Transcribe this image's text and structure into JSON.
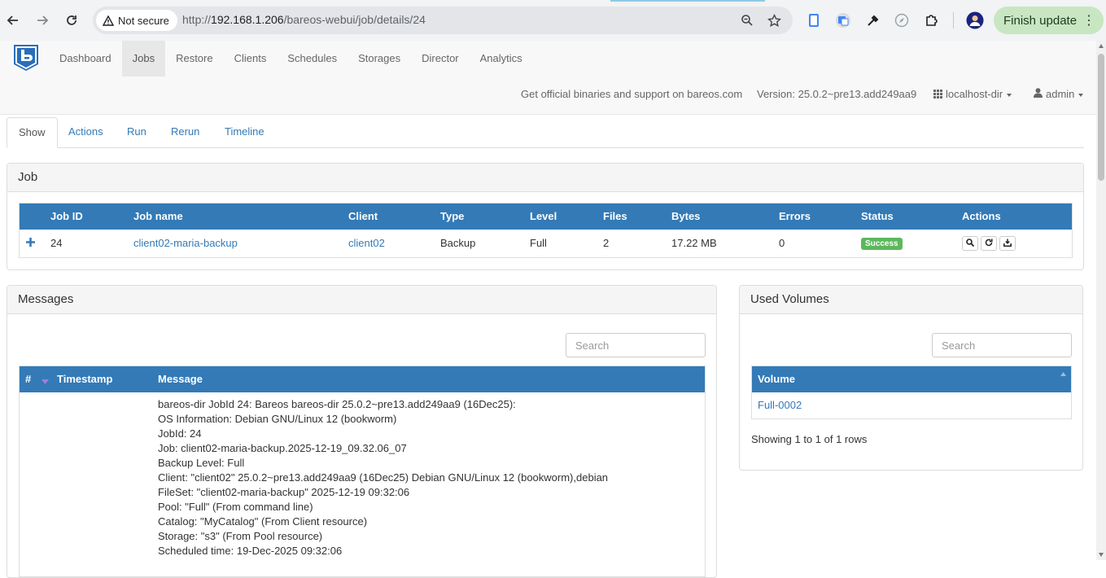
{
  "browser": {
    "secure_label": "Not secure",
    "url_scheme": "http://",
    "url_host": "192.168.1.206",
    "url_path": "/bareos-webui/job/details/24",
    "update_button": "Finish update"
  },
  "navbar": {
    "menu": [
      "Dashboard",
      "Jobs",
      "Restore",
      "Clients",
      "Schedules",
      "Storages",
      "Director",
      "Analytics"
    ],
    "active_menu": "Jobs",
    "support_text": "Get official binaries and support on bareos.com",
    "version_text": "Version: 25.0.2~pre13.add249aa9",
    "director": "localhost-dir",
    "user": "admin"
  },
  "tabs": [
    "Show",
    "Actions",
    "Run",
    "Rerun",
    "Timeline"
  ],
  "job_panel": {
    "title": "Job",
    "columns": [
      "Job ID",
      "Job name",
      "Client",
      "Type",
      "Level",
      "Files",
      "Bytes",
      "Errors",
      "Status",
      "Actions"
    ],
    "row": {
      "job_id": "24",
      "job_name": "client02-maria-backup",
      "client": "client02",
      "type": "Backup",
      "level": "Full",
      "files": "2",
      "bytes": "17.22 MB",
      "errors": "0",
      "status": "Success"
    }
  },
  "messages_panel": {
    "title": "Messages",
    "search_placeholder": "Search",
    "columns": [
      "#",
      "Timestamp",
      "Message"
    ],
    "lines": [
      "bareos-dir JobId 24: Bareos bareos-dir 25.0.2~pre13.add249aa9 (16Dec25):",
      "OS Information: Debian GNU/Linux 12 (bookworm)",
      "JobId: 24",
      "Job: client02-maria-backup.2025-12-19_09.32.06_07",
      "Backup Level: Full",
      "Client: \"client02\" 25.0.2~pre13.add249aa9 (16Dec25) Debian GNU/Linux 12 (bookworm),debian",
      "FileSet: \"client02-maria-backup\" 2025-12-19 09:32:06",
      "Pool: \"Full\" (From command line)",
      "Catalog: \"MyCatalog\" (From Client resource)",
      "Storage: \"s3\" (From Pool resource)",
      "Scheduled time: 19-Dec-2025 09:32:06"
    ]
  },
  "volumes_panel": {
    "title": "Used Volumes",
    "search_placeholder": "Search",
    "column": "Volume",
    "volumes": [
      "Full-0002"
    ],
    "footer": "Showing 1 to 1 of 1 rows"
  },
  "colors": {
    "primary": "#337ab7",
    "success": "#5cb85c",
    "navbar_bg": "#f8f8f8"
  },
  "icons": [
    "back-icon",
    "forward-icon",
    "reload-icon",
    "warning-icon",
    "zoom-icon",
    "bookmark-star-icon",
    "bareos-logo-icon",
    "grid-icon",
    "user-icon",
    "plus-icon",
    "search-icon",
    "refresh-icon",
    "restore-icon",
    "sort-icon"
  ]
}
